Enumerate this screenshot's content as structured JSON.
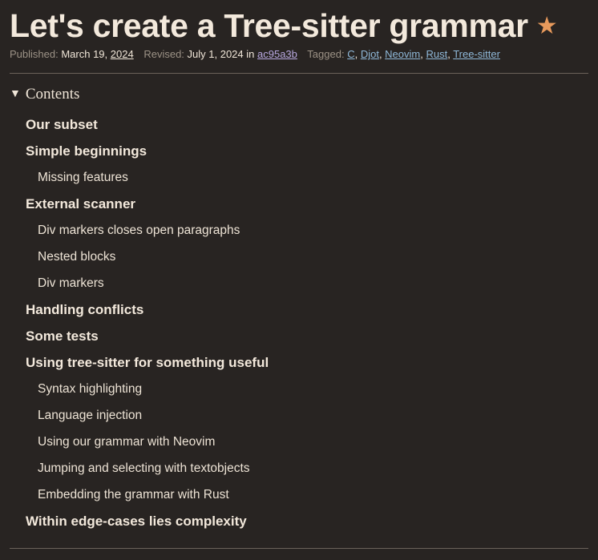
{
  "article": {
    "title": "Let's create a Tree-sitter grammar",
    "star": "★"
  },
  "meta": {
    "published_label": "Published:",
    "published_day": "March 19,",
    "published_year": "2024",
    "revised_label": "Revised:",
    "revised_date": "July 1, 2024",
    "in_label": "in",
    "commit": "ac95a3b",
    "tagged_label": "Tagged:",
    "tags": [
      "C",
      "Djot",
      "Neovim",
      "Rust",
      "Tree-sitter"
    ]
  },
  "toc": {
    "summary": "Contents",
    "items": [
      {
        "level": 1,
        "label": "Our subset"
      },
      {
        "level": 1,
        "label": "Simple beginnings"
      },
      {
        "level": 2,
        "label": "Missing features"
      },
      {
        "level": 1,
        "label": "External scanner"
      },
      {
        "level": 2,
        "label": "Div markers closes open paragraphs"
      },
      {
        "level": 2,
        "label": "Nested blocks"
      },
      {
        "level": 2,
        "label": "Div markers"
      },
      {
        "level": 1,
        "label": "Handling conflicts"
      },
      {
        "level": 1,
        "label": "Some tests"
      },
      {
        "level": 1,
        "label": "Using tree-sitter for something useful"
      },
      {
        "level": 2,
        "label": "Syntax highlighting"
      },
      {
        "level": 2,
        "label": "Language injection"
      },
      {
        "level": 2,
        "label": "Using our grammar with Neovim"
      },
      {
        "level": 2,
        "label": "Jumping and selecting with textobjects"
      },
      {
        "level": 2,
        "label": "Embedding the grammar with Rust"
      },
      {
        "level": 1,
        "label": "Within edge-cases lies complexity"
      }
    ]
  },
  "colors": {
    "background": "#282422",
    "text": "#f3e9dc",
    "accent_star": "#e89a5c",
    "link": "#8fb8d8",
    "commit_link": "#b8a8e0",
    "muted": "#9c9286"
  }
}
